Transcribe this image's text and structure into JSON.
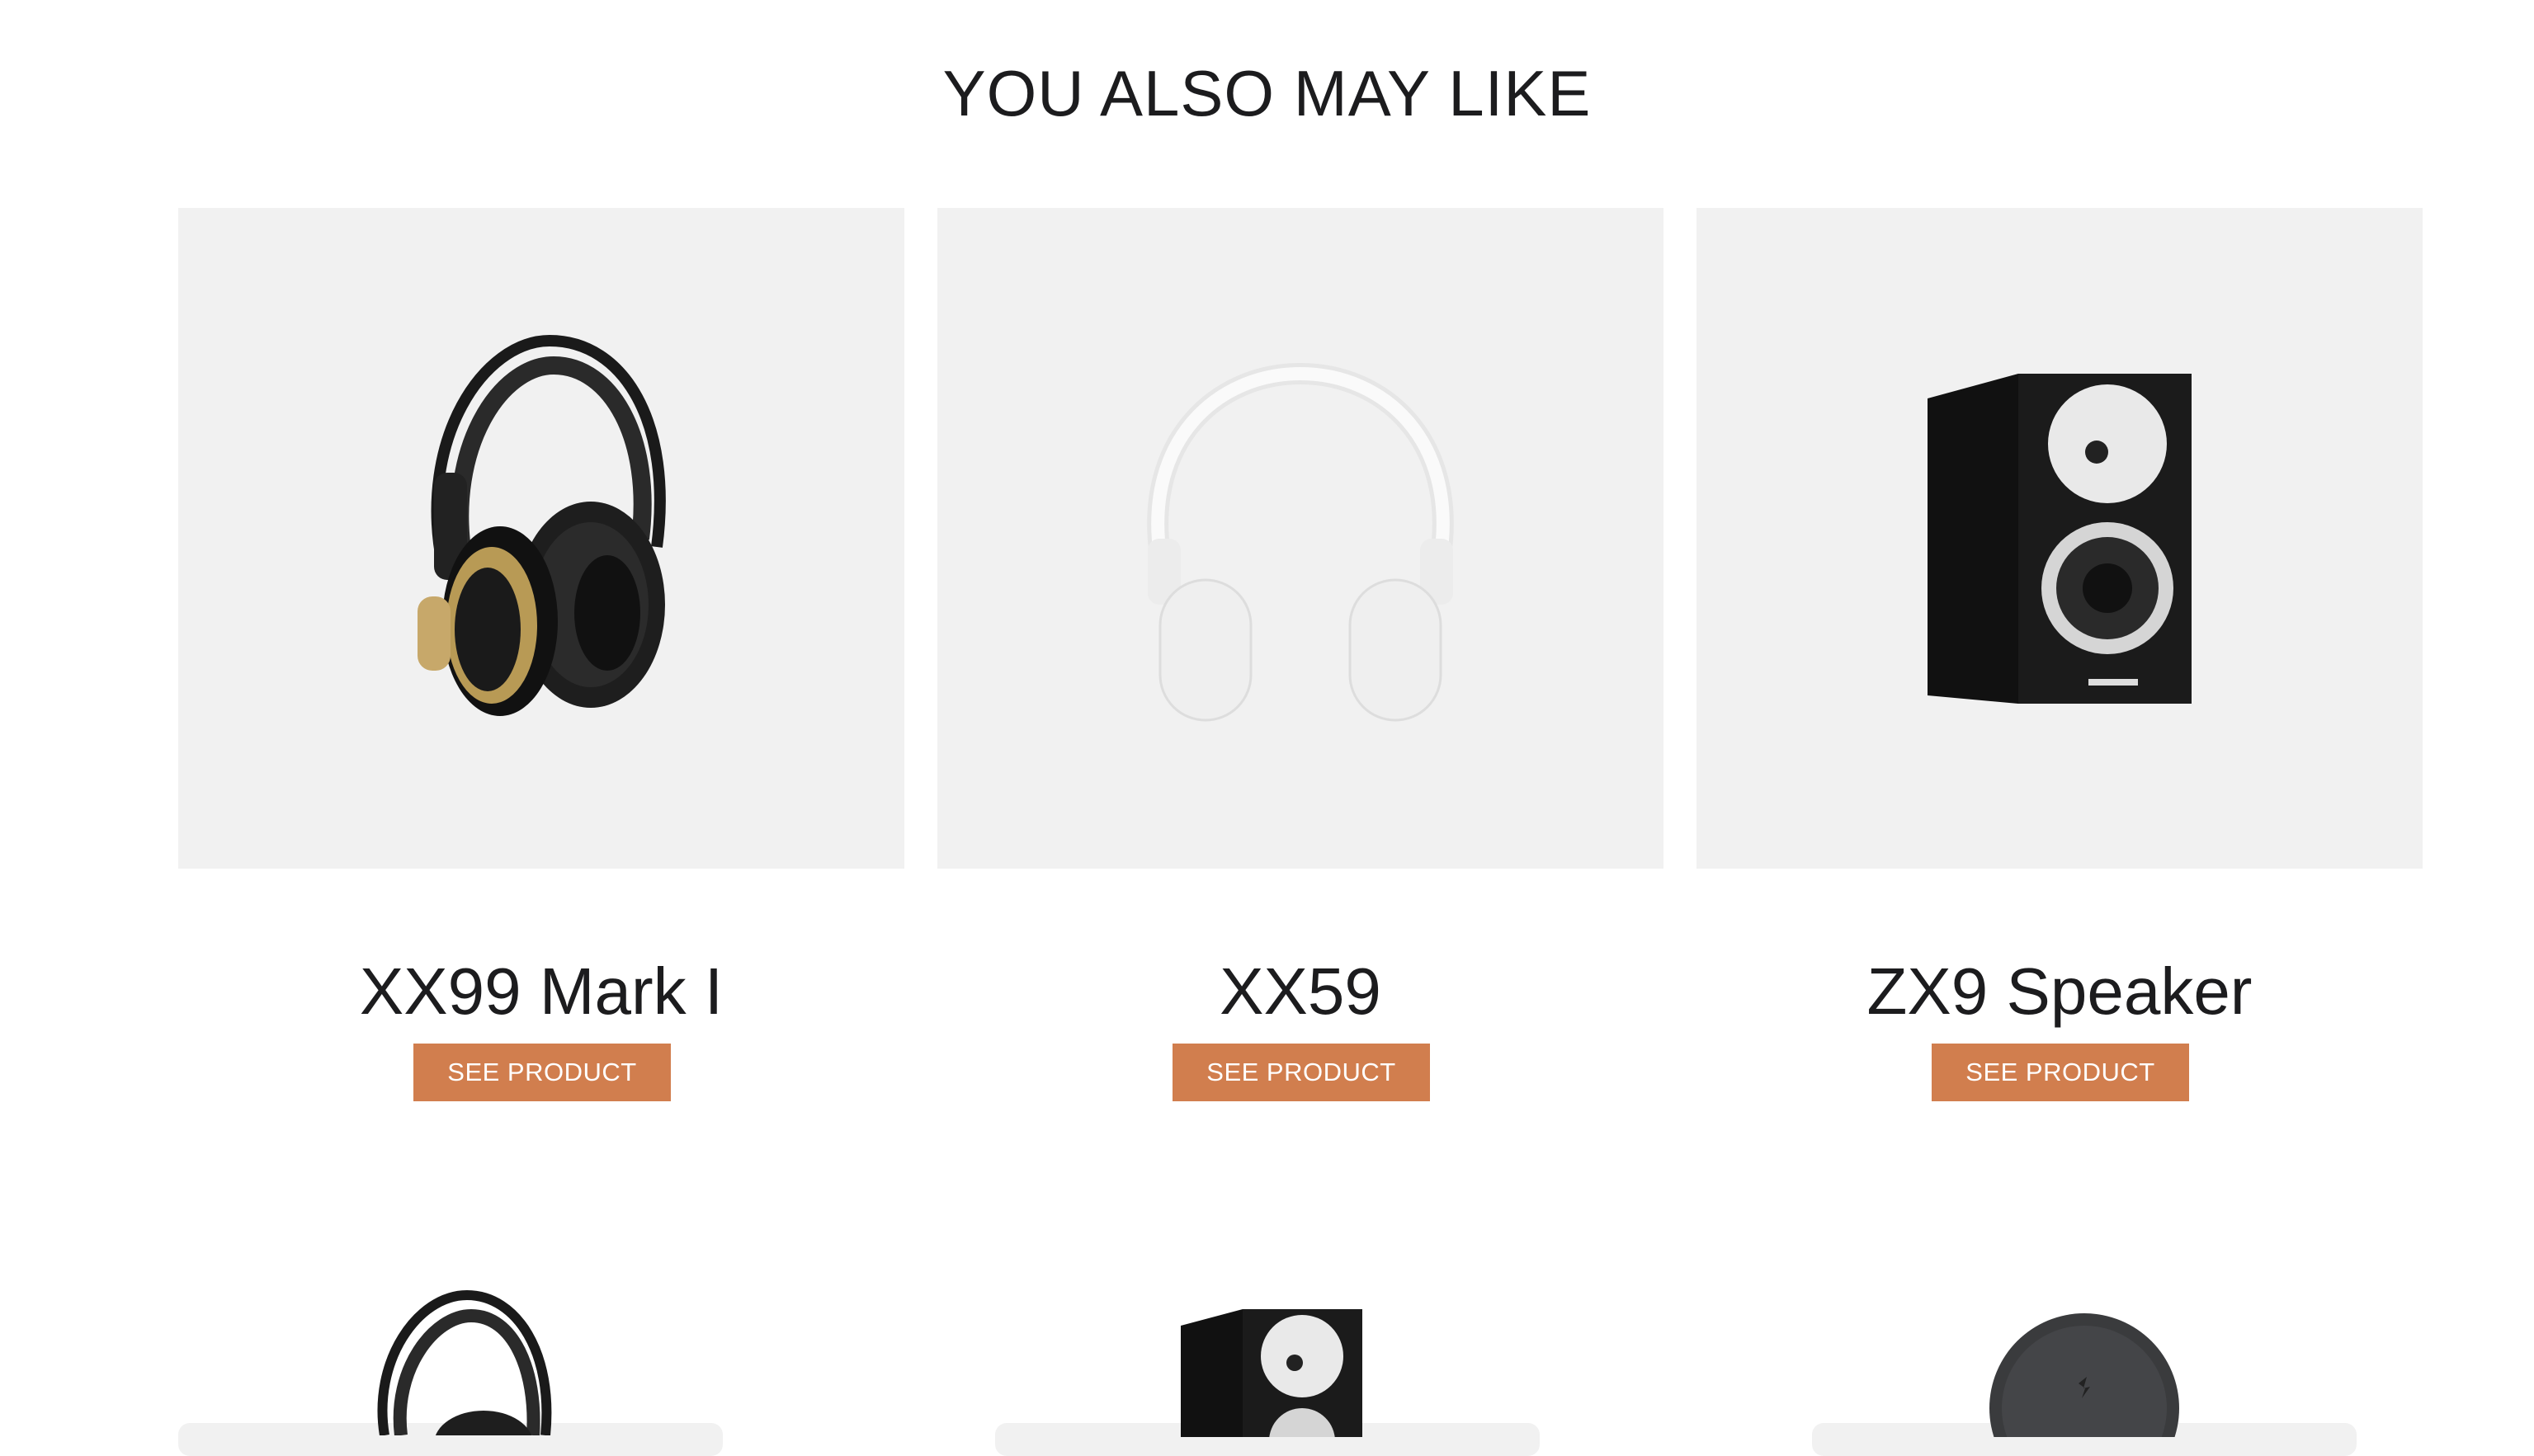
{
  "section": {
    "title": "YOU ALSO MAY LIKE"
  },
  "products": [
    {
      "name": "XX99 Mark I",
      "button_label": "SEE PRODUCT",
      "image_icon": "studio-headphones-icon"
    },
    {
      "name": "XX59",
      "button_label": "SEE PRODUCT",
      "image_icon": "white-headphones-icon"
    },
    {
      "name": "ZX9 Speaker",
      "button_label": "SEE PRODUCT",
      "image_icon": "speaker-icon"
    }
  ],
  "next_row_images": [
    "studio-headphones-icon",
    "speaker-icon",
    "round-earphone-case-icon"
  ],
  "colors": {
    "accent": "#d17e4e",
    "card_bg": "#f1f1f1",
    "text": "#1c1c1e",
    "background": "#ffffff"
  }
}
